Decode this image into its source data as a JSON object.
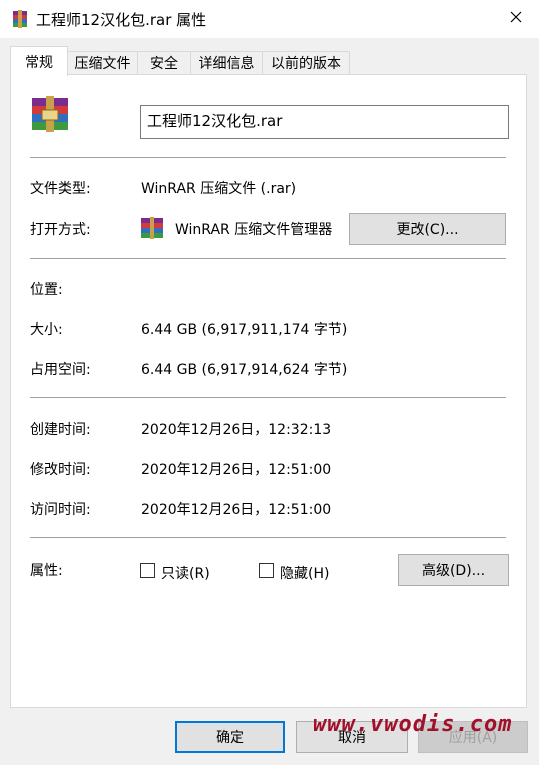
{
  "window": {
    "title": "工程师12汉化包.rar 属性",
    "close_glyph": "✕"
  },
  "tabs": [
    {
      "label": "常规",
      "active": true
    },
    {
      "label": "压缩文件"
    },
    {
      "label": "安全"
    },
    {
      "label": "详细信息"
    },
    {
      "label": "以前的版本"
    }
  ],
  "general": {
    "file_name": "工程师12汉化包.rar",
    "file_type_label": "文件类型:",
    "file_type_value": "WinRAR 压缩文件 (.rar)",
    "open_with_label": "打开方式:",
    "open_with_value": "WinRAR 压缩文件管理器",
    "change_button": "更改(C)...",
    "location_label": "位置:",
    "location_value": "",
    "size_label": "大小:",
    "size_value": "6.44 GB (6,917,911,174 字节)",
    "disk_size_label": "占用空间:",
    "disk_size_value": "6.44 GB (6,917,914,624 字节)",
    "created_label": "创建时间:",
    "created_value": "2020年12月26日，12:32:13",
    "modified_label": "修改时间:",
    "modified_value": "2020年12月26日，12:51:00",
    "accessed_label": "访问时间:",
    "accessed_value": "2020年12月26日，12:51:00",
    "attributes_label": "属性:",
    "readonly_label": "只读(R)",
    "readonly_checked": false,
    "hidden_label": "隐藏(H)",
    "hidden_checked": false,
    "advanced_button": "高级(D)..."
  },
  "footer": {
    "ok": "确定",
    "cancel": "取消",
    "apply": "应用(A)"
  },
  "watermark": "www.vwodis.com",
  "icons": {
    "app": "winrar-archive-icon",
    "close": "close-icon"
  },
  "colors": {
    "accent_border": "#0078d7",
    "watermark": "#a0102a"
  }
}
